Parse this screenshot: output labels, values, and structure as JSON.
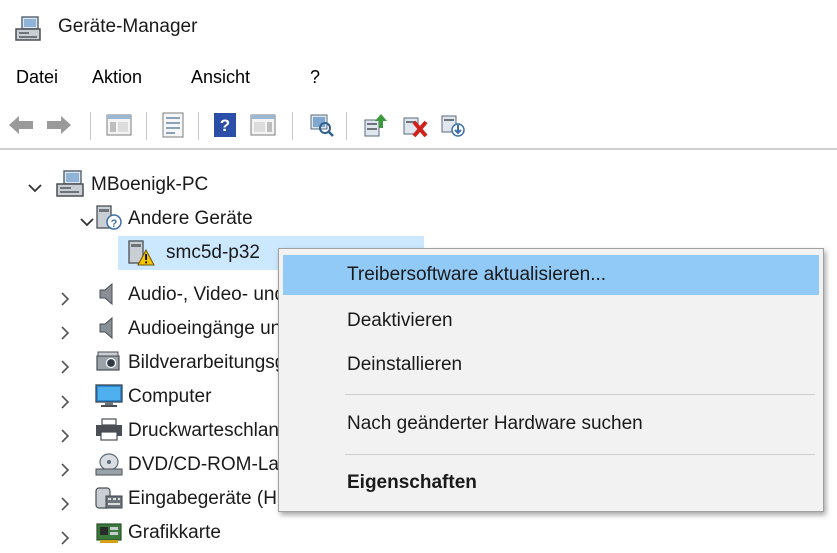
{
  "window": {
    "title": "Geräte-Manager",
    "icon": "device-manager-icon"
  },
  "menu": {
    "file": "Datei",
    "action": "Aktion",
    "view": "Ansicht",
    "help": "?"
  },
  "toolbar": {
    "buttons": [
      "back-icon",
      "forward-icon",
      "show-hide-console-tree-icon",
      "properties-icon",
      "help-icon",
      "action-pane-icon",
      "scan-hardware-icon",
      "update-driver-icon",
      "disable-device-icon",
      "uninstall-device-icon"
    ]
  },
  "tree": {
    "root": "MBoenigk-PC",
    "other_devices": "Andere Geräte",
    "selected_device": "smc5d-p32",
    "items": [
      {
        "label": "Audio-, Video- und Gamecontroller"
      },
      {
        "label": "Audioeingänge und -ausgänge"
      },
      {
        "label": "Bildverarbeitungsgeräte"
      },
      {
        "label": "Computer"
      },
      {
        "label": "Druckwarteschlangen"
      },
      {
        "label": "DVD/CD-ROM-Laufwerke"
      },
      {
        "label": "Eingabegeräte (Human Interface Devices)"
      },
      {
        "label": "Grafikkarte"
      }
    ]
  },
  "context_menu": {
    "update_driver": "Treibersoftware aktualisieren...",
    "disable": "Deaktivieren",
    "uninstall": "Deinstallieren",
    "scan": "Nach geänderter Hardware suchen",
    "properties": "Eigenschaften"
  },
  "colors": {
    "selection": "#cce8ff",
    "menu_highlight": "#91c9f7",
    "menu_bg": "#f2f2f2"
  }
}
